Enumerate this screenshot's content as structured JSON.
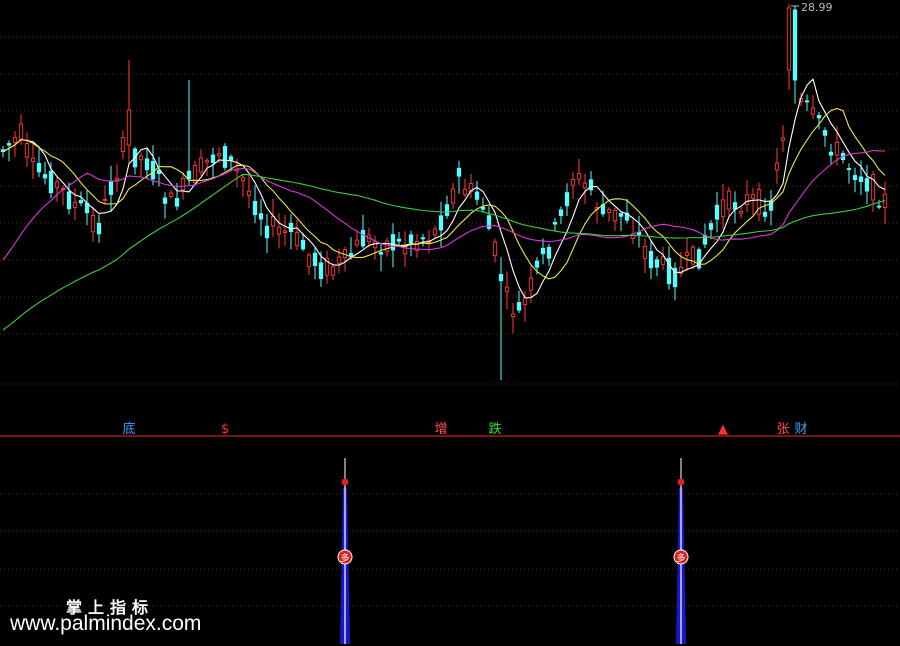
{
  "colors": {
    "background": "#000000",
    "up": "#ff3b3b",
    "down": "#54ffff",
    "grid": "#7a1a1a",
    "divider": "#c81e1e",
    "ma_white": "#ffffff",
    "ma_yellow": "#e8e84a",
    "ma_magenta": "#d838d8",
    "ma_green": "#3ccc3c",
    "spike_blue": "#1818c8",
    "marker_red": "#e02020"
  },
  "chart_data": [
    {
      "type": "candlestick",
      "panel": "main",
      "last_high_label": "28.99",
      "grid": true,
      "signal_labels": [
        {
          "text": "底",
          "color": "#3aa0ff",
          "index": 21
        },
        {
          "text": "$",
          "color": "#ff3030",
          "index": 37
        },
        {
          "text": "增",
          "color": "#ff5050",
          "index": 73
        },
        {
          "text": "跌",
          "color": "#30e030",
          "index": 82
        },
        {
          "text": "▲",
          "color": "#ff3030",
          "index": 120
        },
        {
          "text": "张",
          "color": "#ff5050",
          "index": 130
        },
        {
          "text": "财",
          "color": "#3aa0ff",
          "index": 133
        }
      ],
      "series": [
        {
          "name": "",
          "color": "#ffffff",
          "kind": "ma5"
        },
        {
          "name": "",
          "color": "#e8e84a",
          "kind": "ma10"
        },
        {
          "name": "",
          "color": "#d838d8",
          "kind": "ma20"
        },
        {
          "name": "",
          "color": "#3ccc3c",
          "kind": "ma60"
        }
      ]
    },
    {
      "type": "bar",
      "panel": "indicator",
      "grid": true,
      "spikes": [
        {
          "index": 57,
          "value": 1.0,
          "marker": "多"
        },
        {
          "index": 113,
          "value": 1.0,
          "marker": "多"
        }
      ]
    }
  ],
  "watermark": {
    "cn": "掌上指标",
    "url": "www.palmindex.com"
  }
}
